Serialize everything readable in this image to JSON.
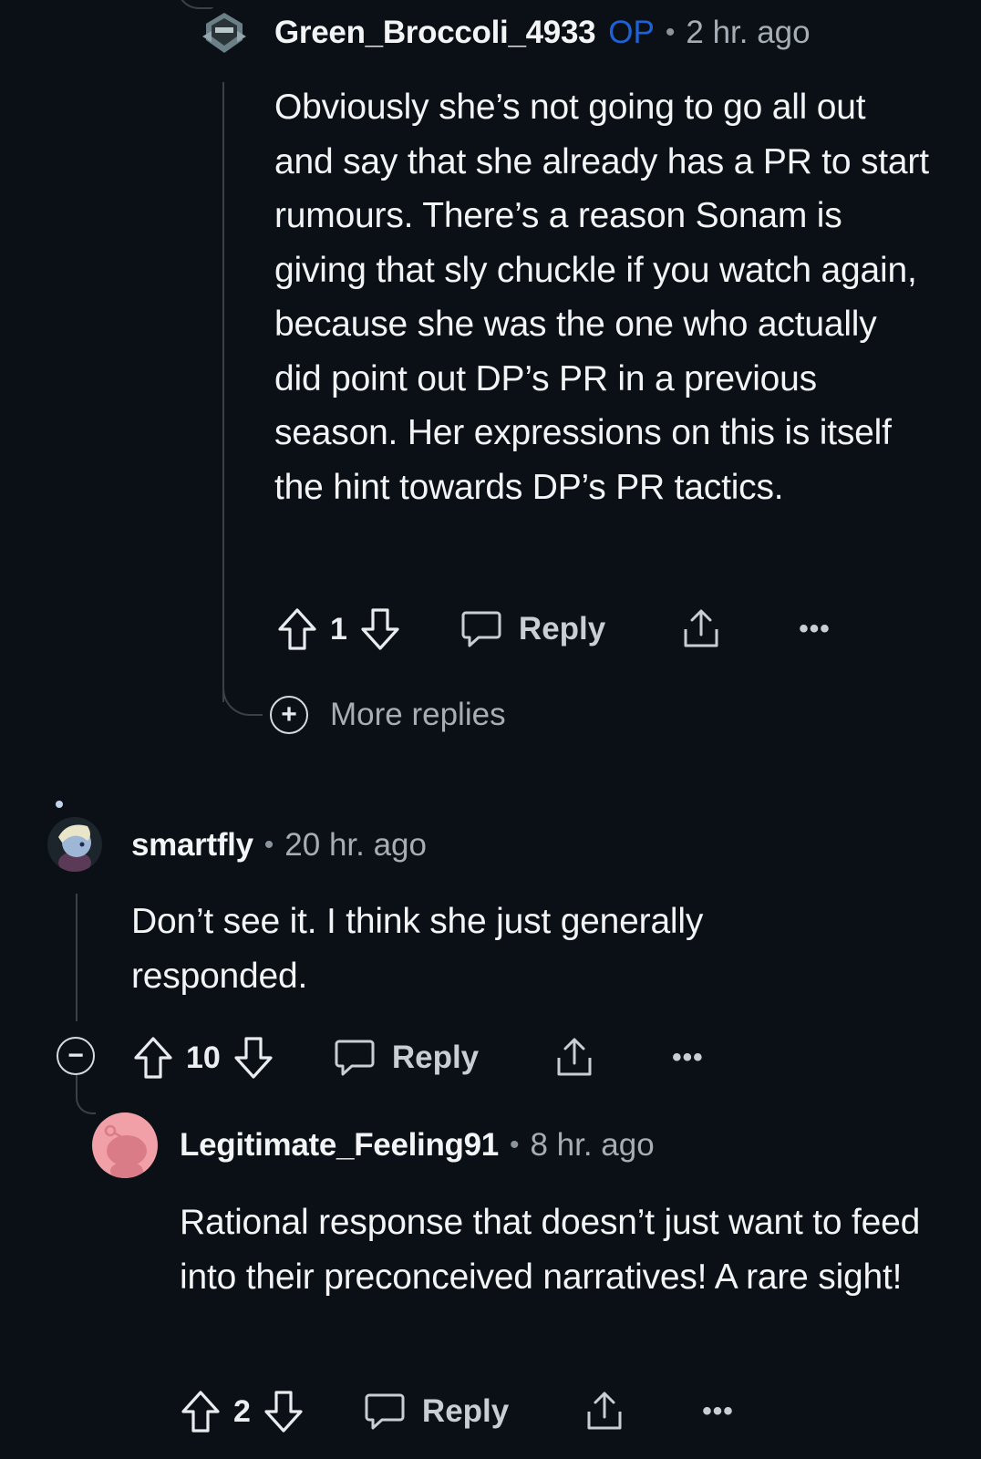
{
  "comments": [
    {
      "username": "Green_Broccoli_4933",
      "op_badge": "OP",
      "separator": "•",
      "time": "2 hr. ago",
      "body": "Obviously she’s not going to go all out and say that she already has a PR to start rumours. There’s a reason Sonam is giving that sly chuckle if you watch again, because she was the one who actually did point out DP’s PR in a previous season. Her expressions on this is itself the hint towards DP’s PR tactics.",
      "votes": "1",
      "reply_label": "Reply",
      "more_label": "•••",
      "avatar_icon": "robot-avatar"
    },
    {
      "username": "smartfly",
      "separator": "•",
      "time": "20 hr. ago",
      "body": "Don’t see it. I think she just generally responded.",
      "votes": "10",
      "reply_label": "Reply",
      "more_label": "•••",
      "avatar_icon": "anime-avatar"
    },
    {
      "username": "Legitimate_Feeling91",
      "separator": "•",
      "time": "8 hr. ago",
      "body": "Rational response that doesn’t just want to feed into their preconceived narratives! A rare sight!",
      "votes": "2",
      "reply_label": "Reply",
      "more_label": "•••",
      "avatar_icon": "snoo-avatar"
    }
  ],
  "more_replies": {
    "icon": "plus-circle-icon",
    "label": "More replies"
  },
  "collapse": {
    "icon": "minus-circle-icon"
  },
  "colors": {
    "background": "#0b1016",
    "op_badge": "#1d62d6",
    "text": "#f2f4f5",
    "muted": "#a6adb4",
    "snoo_bg": "#f2a0a8"
  }
}
